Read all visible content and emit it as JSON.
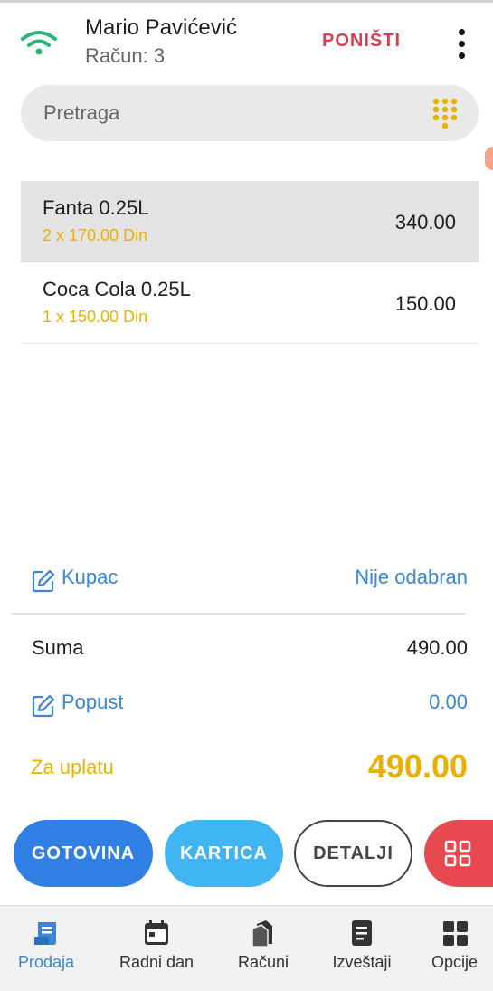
{
  "header": {
    "user_name": "Mario Pavićević",
    "receipt_label": "Račun: 3",
    "cancel_label": "PONIŠTI",
    "status_icon": "wifi-icon",
    "menu_icon": "more-vert-icon"
  },
  "search": {
    "placeholder": "Pretraga",
    "icon": "dialpad-icon"
  },
  "items": [
    {
      "name": "Fanta 0.25L",
      "qty_price": "2 x 170.00 Din",
      "total": "340.00",
      "selected": true
    },
    {
      "name": "Coca Cola 0.25L",
      "qty_price": "1 x 150.00 Din",
      "total": "150.00",
      "selected": false
    }
  ],
  "customer": {
    "label": "Kupac",
    "value": "Nije odabran",
    "icon": "edit-icon"
  },
  "summary": {
    "sum_label": "Suma",
    "sum_value": "490.00",
    "discount_label": "Popust",
    "discount_value": "0.00",
    "pay_label": "Za uplatu",
    "pay_value": "490.00"
  },
  "actions": {
    "cash": "GOTOVINA",
    "card": "KARTICA",
    "details": "DETALJI",
    "grid_icon": "grid-icon"
  },
  "nav": [
    {
      "label": "Prodaja",
      "icon": "sale-icon",
      "active": true
    },
    {
      "label": "Radni dan",
      "icon": "calendar-icon",
      "active": false
    },
    {
      "label": "Računi",
      "icon": "receipts-icon",
      "active": false
    },
    {
      "label": "Izveštaji",
      "icon": "report-icon",
      "active": false
    },
    {
      "label": "Opcije",
      "icon": "options-icon",
      "active": false
    }
  ],
  "colors": {
    "accent_blue": "#3a86d9",
    "cancel_red": "#d9404f",
    "amount_yellow": "#eab000",
    "cash_button": "#2f7fe5",
    "card_button": "#3fb6f3",
    "grid_button": "#e8484f",
    "wifi_green": "#2bb673"
  }
}
